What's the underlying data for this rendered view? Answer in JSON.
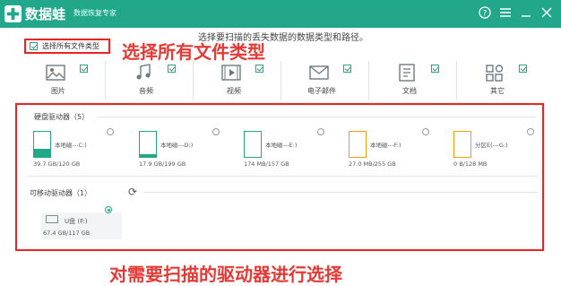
{
  "app": {
    "title": "数据蛙",
    "subtitle": "数据恢复专家"
  },
  "titlebar_icons": [
    "help-icon",
    "menu-icon",
    "minimize-icon",
    "close-icon"
  ],
  "instruction": "选择要扫描的丢失数据的数据类型和路径。",
  "select_all": {
    "label": "选择所有文件类型",
    "checked": true
  },
  "annotation_top": "选择所有文件类型",
  "annotation_bottom": "对需要扫描的驱动器进行选择",
  "file_types": [
    {
      "label": "图片",
      "icon": "image-icon",
      "checked": true
    },
    {
      "label": "音频",
      "icon": "audio-icon",
      "checked": true
    },
    {
      "label": "视频",
      "icon": "video-icon",
      "checked": true
    },
    {
      "label": "电子邮件",
      "icon": "email-icon",
      "checked": true
    },
    {
      "label": "文档",
      "icon": "document-icon",
      "checked": true
    },
    {
      "label": "其它",
      "icon": "other-icon",
      "checked": true
    }
  ],
  "hard_drives": {
    "label": "硬盘驱动器（5）",
    "items": [
      {
        "name": "本地磁---C:)",
        "size": "39.7 GB/120 GB",
        "fill": 0.33,
        "color": "#22a78b",
        "selected": false
      },
      {
        "name": "本地磁---D:)",
        "size": "17.9 GB/199 GB",
        "fill": 0.09,
        "color": "#22a78b",
        "selected": false
      },
      {
        "name": "本地磁---E:)",
        "size": "174 MB/157 GB",
        "fill": 0.01,
        "color": "#22a78b",
        "selected": false
      },
      {
        "name": "本地磁---F:)",
        "size": "27.0 MB/255 GB",
        "fill": 0.01,
        "color": "#f59c1a",
        "selected": false
      },
      {
        "name": "分区E(---G:)",
        "size": "0 B/128 MB",
        "fill": 0.0,
        "color": "#f59c1a",
        "selected": false
      }
    ]
  },
  "removable_drives": {
    "label": "可移动驱动器（1）",
    "items": [
      {
        "name": "U盘 (F:)",
        "size": "67.4 GB/117 GB",
        "selected": true
      }
    ]
  },
  "colors": {
    "accent": "#22a78b",
    "annotation": "#e53935"
  }
}
